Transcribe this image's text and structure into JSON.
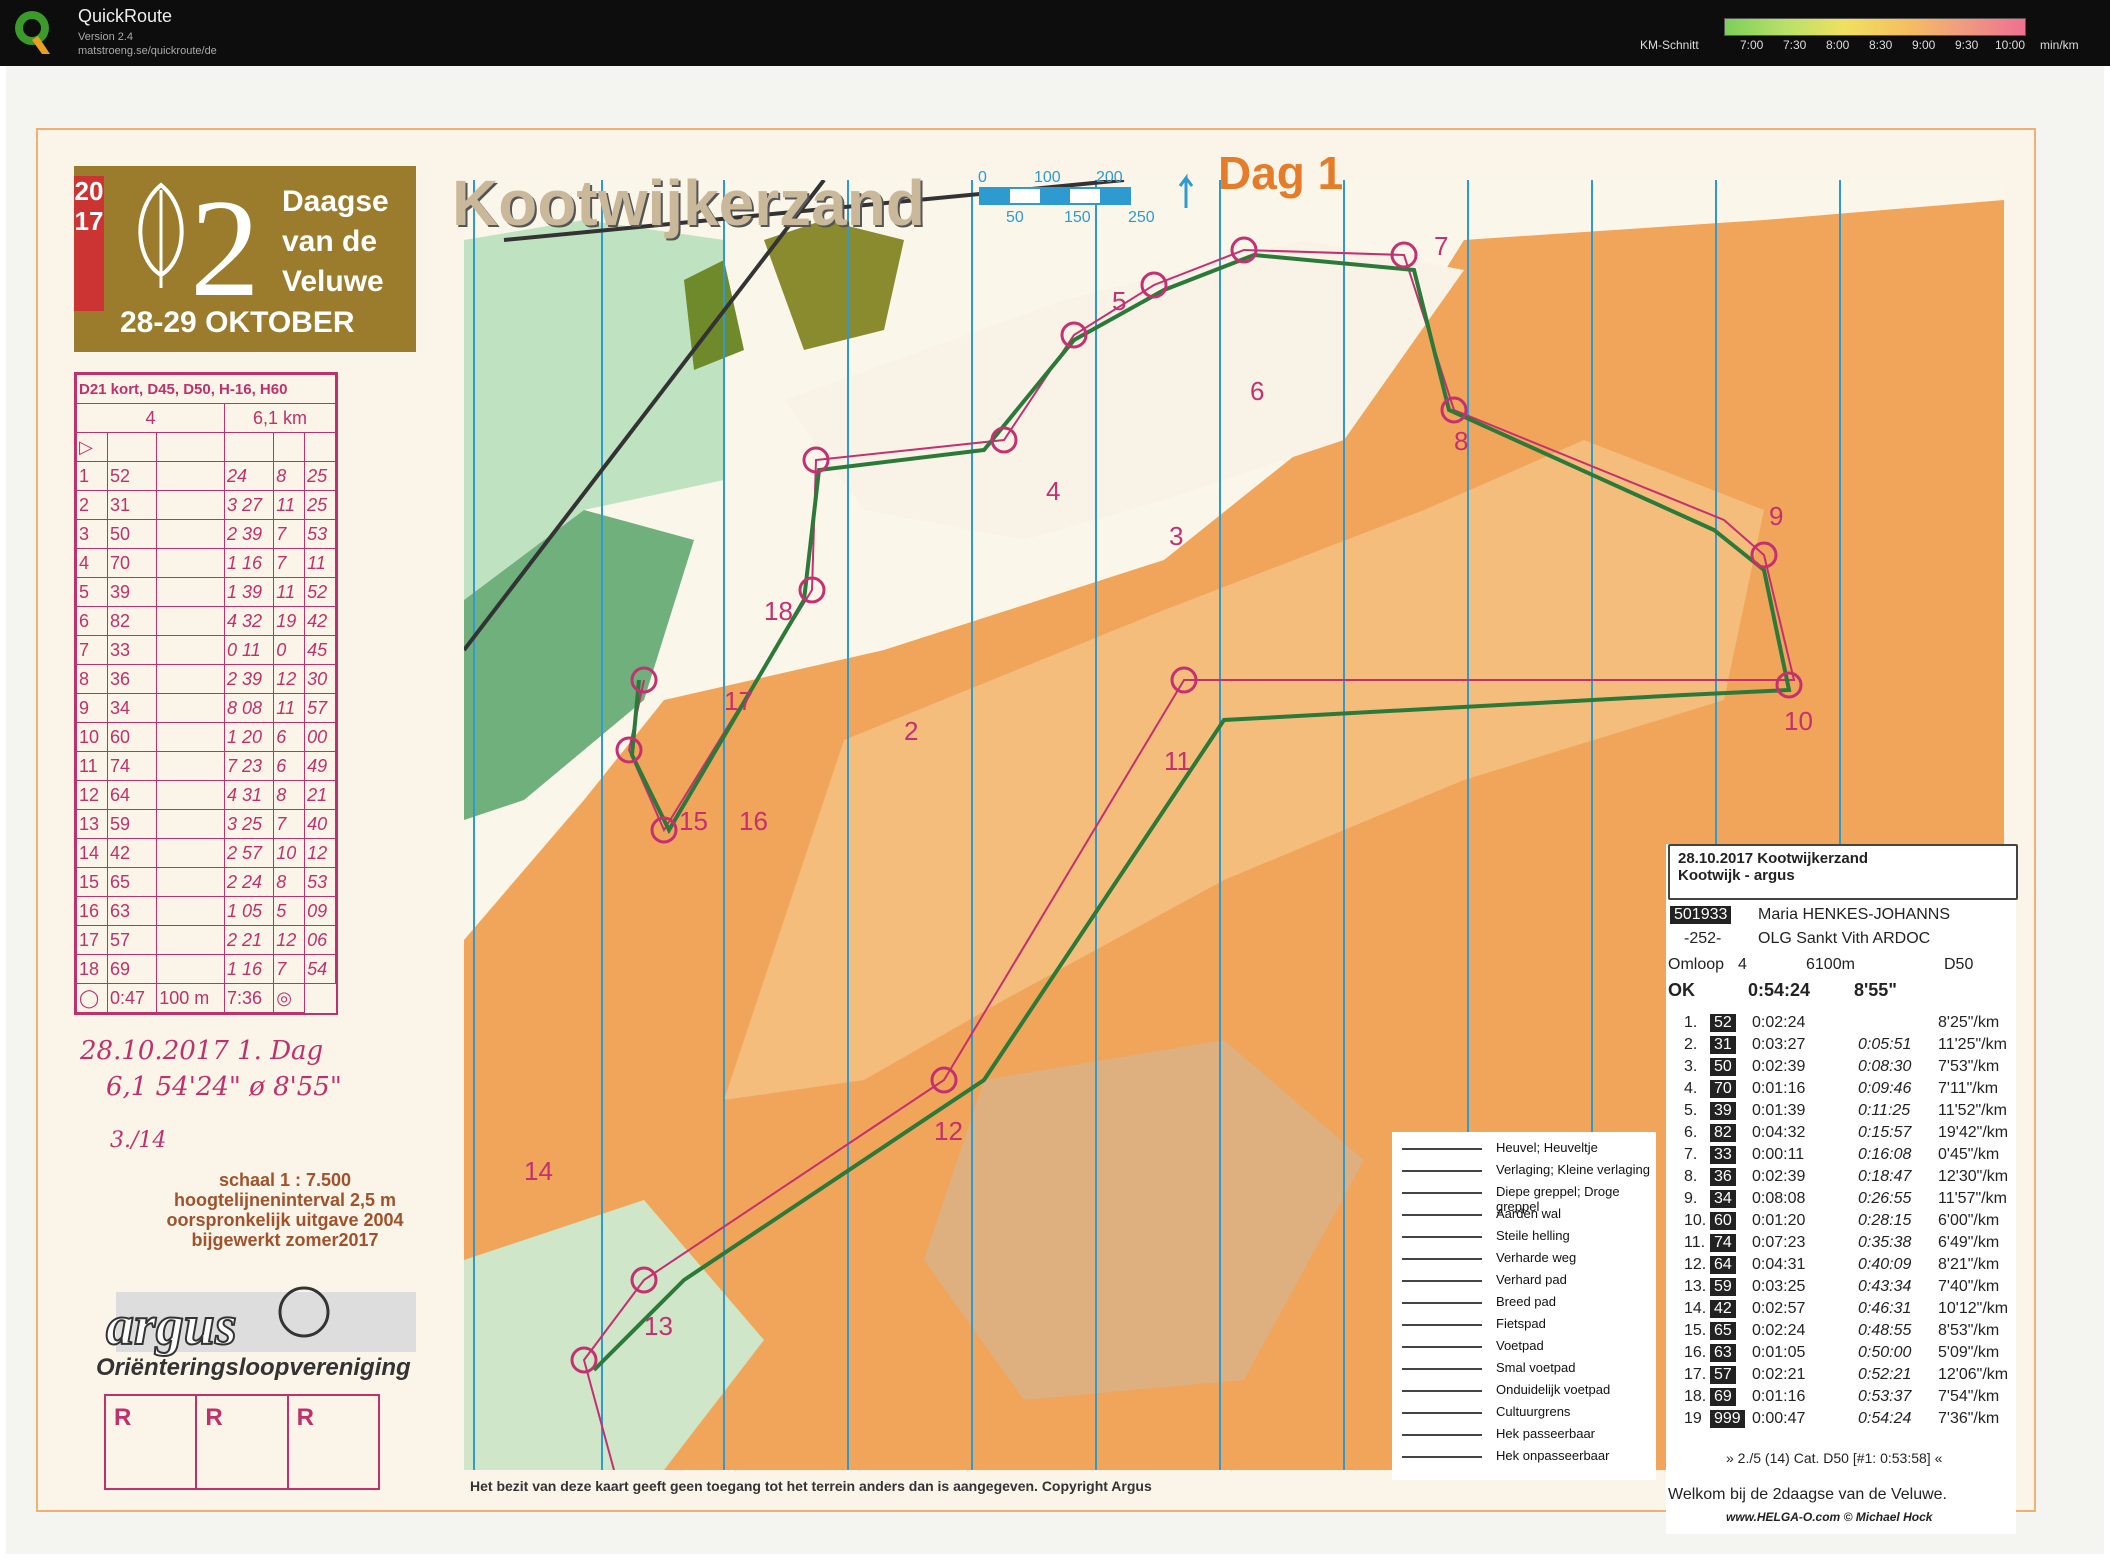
{
  "app": {
    "title": "QuickRoute",
    "version": "Version 2.4",
    "url": "matstroeng.se/quickroute/de",
    "km_label": "KM-Schnitt",
    "scale_ticks": [
      "7:00",
      "7:30",
      "8:00",
      "8:30",
      "9:00",
      "9:30",
      "10:00",
      "min/km"
    ]
  },
  "event": {
    "year": "2017",
    "number": "2",
    "name": "Daagse van de Veluwe",
    "dates": "28-29 OKTOBER",
    "map_title": "Kootwijkerzand",
    "day": "Dag 1",
    "scale_labels": [
      "0",
      "100",
      "200",
      "50",
      "150",
      "250"
    ]
  },
  "course_card": {
    "classes": "D21 kort, D45, D50, H-16, H60",
    "course": "4",
    "length": "6,1 km",
    "rows": [
      [
        "1",
        "52",
        "24",
        "8",
        "25"
      ],
      [
        "2",
        "31",
        "3 27",
        "11",
        "25"
      ],
      [
        "3",
        "50",
        "2 39",
        "7",
        "53"
      ],
      [
        "4",
        "70",
        "1 16",
        "7",
        "11"
      ],
      [
        "5",
        "39",
        "1 39",
        "11",
        "52"
      ],
      [
        "6",
        "82",
        "4 32",
        "19",
        "42"
      ],
      [
        "7",
        "33",
        "0 11",
        "0",
        "45"
      ],
      [
        "8",
        "36",
        "2 39",
        "12",
        "30"
      ],
      [
        "9",
        "34",
        "8 08",
        "11",
        "57"
      ],
      [
        "10",
        "60",
        "1 20",
        "6",
        "00"
      ],
      [
        "11",
        "74",
        "7 23",
        "6",
        "49"
      ],
      [
        "12",
        "64",
        "4 31",
        "8",
        "21"
      ],
      [
        "13",
        "59",
        "3 25",
        "7",
        "40"
      ],
      [
        "14",
        "42",
        "2 57",
        "10",
        "12"
      ],
      [
        "15",
        "65",
        "2 24",
        "8",
        "53"
      ],
      [
        "16",
        "63",
        "1 05",
        "5",
        "09"
      ],
      [
        "17",
        "57",
        "2 21",
        "12",
        "06"
      ],
      [
        "18",
        "69",
        "1 16",
        "7",
        "54"
      ]
    ],
    "finish": [
      "0:47",
      "100 m",
      "7:36"
    ]
  },
  "handwritten": {
    "line1": "28.10.2017  1. Dag",
    "line2": "6,1  54'24\"  ø 8'55\"",
    "place": "3./14"
  },
  "map_meta": {
    "scale": "schaal  1 : 7.500",
    "contour": "hoogtelijneninterval  2,5 m",
    "original": "oorspronkelijk uitgave 2004",
    "updated": "bijgewerkt zomer2017",
    "club_logo": "argus",
    "club": "Oriënteringsloopvereniging",
    "rboxes": [
      "R",
      "R",
      "R"
    ],
    "copyright": "Het bezit van deze kaart geeft geen toegang tot het terrein anders dan is aangegeven. Copyright Argus"
  },
  "legend": [
    "Heuvel; Heuveltje",
    "Verlaging; Kleine verlaging",
    "Diepe greppel; Droge greppel",
    "Aarden wal",
    "Steile helling",
    "Verharde weg",
    "Verhard pad",
    "Breed pad",
    "Fietspad",
    "Voetpad",
    "Smal voetpad",
    "Onduidelijk voetpad",
    "Cultuurgrens",
    "Hek passeerbaar",
    "Hek onpasseerbaar"
  ],
  "splits": {
    "date_event": "28.10.2017  Kootwijkerzand",
    "subtitle": "Kootwijk - argus",
    "id": "501933",
    "name": "Maria HENKES-JOHANNS",
    "bib": "-252-",
    "club": "OLG Sankt Vith ARDOC",
    "course_label": "Omloop",
    "course": "4",
    "distance": "6100m",
    "category": "D50",
    "status": "OK",
    "total": "0:54:24",
    "pace": "8'55\"",
    "rows": [
      [
        "1.",
        "52",
        "0:02:24",
        "",
        "8'25\"/km"
      ],
      [
        "2.",
        "31",
        "0:03:27",
        "0:05:51",
        "11'25\"/km"
      ],
      [
        "3.",
        "50",
        "0:02:39",
        "0:08:30",
        "7'53\"/km"
      ],
      [
        "4.",
        "70",
        "0:01:16",
        "0:09:46",
        "7'11\"/km"
      ],
      [
        "5.",
        "39",
        "0:01:39",
        "0:11:25",
        "11'52\"/km"
      ],
      [
        "6.",
        "82",
        "0:04:32",
        "0:15:57",
        "19'42\"/km"
      ],
      [
        "7.",
        "33",
        "0:00:11",
        "0:16:08",
        "0'45\"/km"
      ],
      [
        "8.",
        "36",
        "0:02:39",
        "0:18:47",
        "12'30\"/km"
      ],
      [
        "9.",
        "34",
        "0:08:08",
        "0:26:55",
        "11'57\"/km"
      ],
      [
        "10.",
        "60",
        "0:01:20",
        "0:28:15",
        "6'00\"/km"
      ],
      [
        "11.",
        "74",
        "0:07:23",
        "0:35:38",
        "6'49\"/km"
      ],
      [
        "12.",
        "64",
        "0:04:31",
        "0:40:09",
        "8'21\"/km"
      ],
      [
        "13.",
        "59",
        "0:03:25",
        "0:43:34",
        "7'40\"/km"
      ],
      [
        "14.",
        "42",
        "0:02:57",
        "0:46:31",
        "10'12\"/km"
      ],
      [
        "15.",
        "65",
        "0:02:24",
        "0:48:55",
        "8'53\"/km"
      ],
      [
        "16.",
        "63",
        "0:01:05",
        "0:50:00",
        "5'09\"/km"
      ],
      [
        "17.",
        "57",
        "0:02:21",
        "0:52:21",
        "12'06\"/km"
      ],
      [
        "18.",
        "69",
        "0:01:16",
        "0:53:37",
        "7'54\"/km"
      ],
      [
        "19",
        "999",
        "0:00:47",
        "0:54:24",
        "7'36\"/km"
      ]
    ],
    "ranking": "» 2./5 (14) Cat. D50 [#1: 0:53:58] «",
    "welcome": "Welkom bij de 2daagse van de Veluwe.",
    "footer": "www.HELGA-O.com © Michael Hock"
  },
  "controls": [
    {
      "n": "2"
    },
    {
      "n": "3"
    },
    {
      "n": "4"
    },
    {
      "n": "5"
    },
    {
      "n": "6"
    },
    {
      "n": "7"
    },
    {
      "n": "8"
    },
    {
      "n": "9"
    },
    {
      "n": "10"
    },
    {
      "n": "11"
    },
    {
      "n": "12"
    },
    {
      "n": "13"
    },
    {
      "n": "14"
    },
    {
      "n": "15"
    },
    {
      "n": "16"
    },
    {
      "n": "17"
    },
    {
      "n": "18"
    }
  ]
}
